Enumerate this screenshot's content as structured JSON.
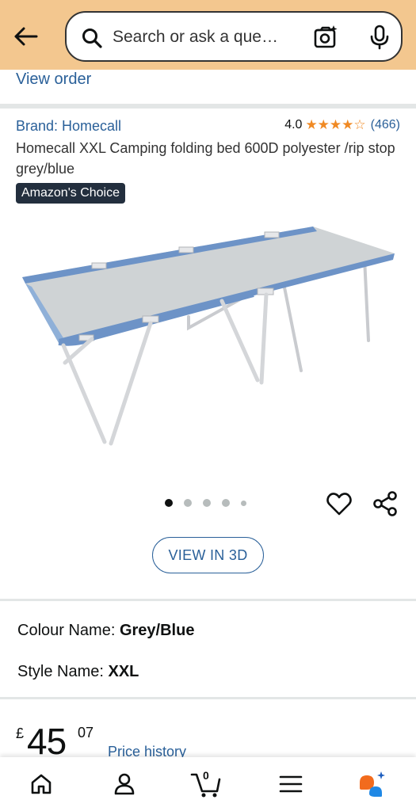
{
  "header": {
    "search_placeholder": "Search or ask a que…",
    "icons": {
      "back": "back-arrow-icon",
      "search": "search-icon",
      "camera": "camera-search-icon",
      "mic": "microphone-icon"
    },
    "background_color": "#f3c78f"
  },
  "order": {
    "view_order_label": "View order"
  },
  "product": {
    "brand": "Brand: Homecall",
    "rating": "4.0",
    "stars": "★★★★☆",
    "rating_value": 4.0,
    "rating_count": "(466)",
    "title": "Homecall XXL Camping folding bed 600D polyester /rip stop grey/blue",
    "badge": "Amazon's Choice",
    "image_alt_icon": "camping-bed-image"
  },
  "carousel": {
    "dot_count": 5,
    "active_index": 0,
    "icons": {
      "wishlist": "heart-icon",
      "share": "share-icon"
    }
  },
  "view_3d_label": "VIEW IN 3D",
  "variations": {
    "colour": {
      "label": "Colour Name:",
      "value": "Grey/Blue"
    },
    "style": {
      "label": "Style Name:",
      "value": "XXL"
    }
  },
  "price": {
    "currency": "£",
    "whole": "45",
    "fraction": "07",
    "history_label": "Price history"
  },
  "bottom_nav": {
    "cart_count": "0",
    "icons": [
      "home-icon",
      "account-icon",
      "cart-icon",
      "menu-icon",
      "rufus-assistant-icon"
    ]
  },
  "colors": {
    "link": "#2a6099",
    "star": "#f08a24",
    "badge_bg": "#232f3e"
  }
}
